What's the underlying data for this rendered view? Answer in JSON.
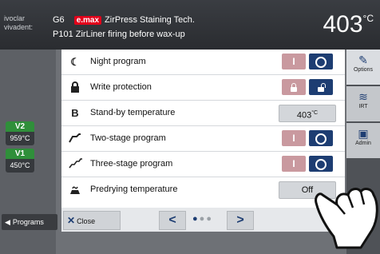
{
  "header": {
    "logo_line1": "ivoclar",
    "logo_line2": "vivadent:",
    "line1_code": "G6",
    "line1_brand": "e.max",
    "line1_title": "ZirPress Staining Tech.",
    "line2_code": "P101",
    "line2_title": "ZirLiner firing before wax-up",
    "temperature": "403",
    "temperature_unit": "°C"
  },
  "left": {
    "v2_label": "V2",
    "v2_value": "959°C",
    "v1_label": "V1",
    "v1_value": "450°C",
    "programs_label": "Programs"
  },
  "dialog": {
    "rows": [
      {
        "label": "Night program",
        "icon": "moon-icon"
      },
      {
        "label": "Write protection",
        "icon": "lock-icon"
      },
      {
        "label": "Stand-by temperature",
        "icon_text": "B",
        "value": "403",
        "value_unit": "°C"
      },
      {
        "label": "Two-stage program",
        "icon": "two-stage-icon"
      },
      {
        "label": "Three-stage program",
        "icon": "three-stage-icon"
      },
      {
        "label": "Predrying temperature",
        "icon": "predrying-icon",
        "value": "Off"
      }
    ],
    "toggle_on": "I",
    "close_label": "Close",
    "prev": "<",
    "next": ">"
  },
  "right": {
    "options_label": "Options",
    "irt_label": "IRT",
    "admin_label": "Admin"
  },
  "colors": {
    "accent": "#1d3d72",
    "toggle_inactive": "#c9999f",
    "green": "#2f8f3a",
    "brand_red": "#e2001a"
  }
}
